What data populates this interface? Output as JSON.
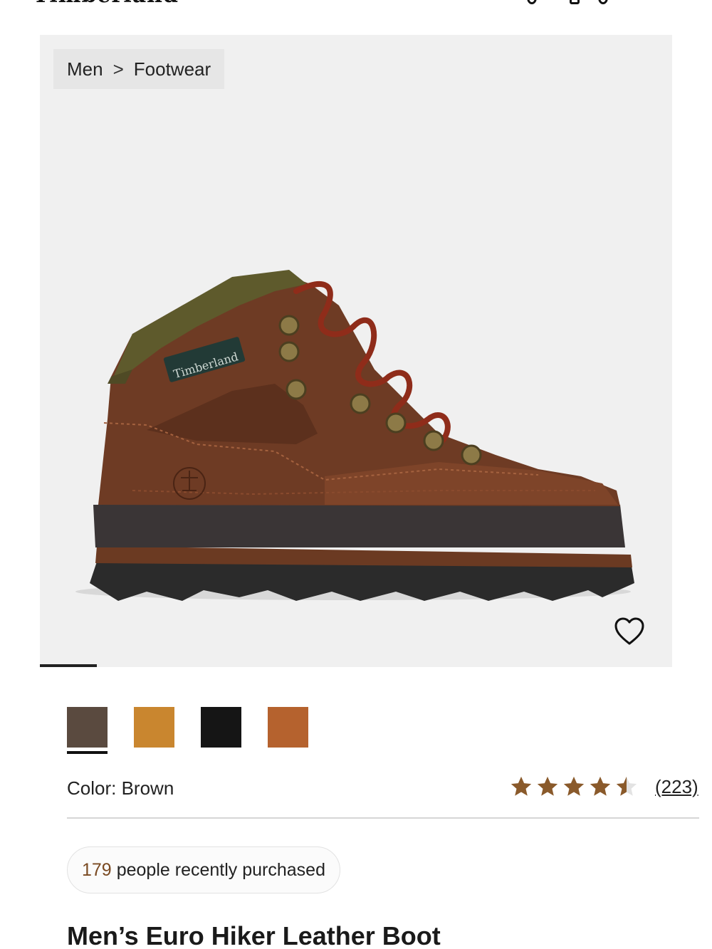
{
  "header": {
    "logo_text": "Timberland"
  },
  "breadcrumb": {
    "items": [
      "Men",
      "Footwear"
    ],
    "separator": ">"
  },
  "product_image": {
    "boot_logo_text": "Timberland",
    "image_position": {
      "current": 1,
      "shown_fraction": 0.09
    }
  },
  "swatches": [
    {
      "name": "Brown",
      "color": "#5a4a3f",
      "selected": true
    },
    {
      "name": "Wheat",
      "color": "#c9862f",
      "selected": false
    },
    {
      "name": "Black",
      "color": "#151515",
      "selected": false
    },
    {
      "name": "Rust",
      "color": "#b5622e",
      "selected": false
    }
  ],
  "color": {
    "label": "Color:",
    "value": "Brown"
  },
  "rating": {
    "value": 4.5,
    "max": 5,
    "count_text": "(223)",
    "star_color": "#8a5a2b"
  },
  "social_proof": {
    "count": "179",
    "text": "people recently purchased",
    "count_color": "#7a4a22"
  },
  "product": {
    "title": "Men’s Euro Hiker Leather Boot"
  }
}
